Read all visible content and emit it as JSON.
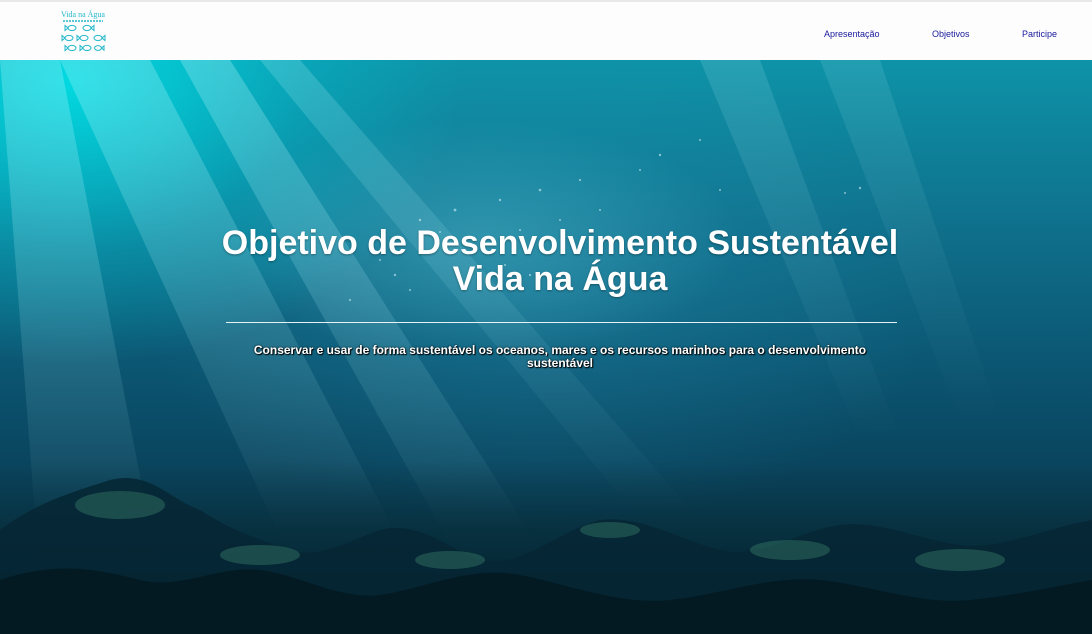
{
  "header": {
    "logo_text": "Vida na Água",
    "nav": [
      {
        "label": "Apresentação"
      },
      {
        "label": "Objetivos"
      },
      {
        "label": "Participe"
      }
    ]
  },
  "hero": {
    "title_line1": "Objetivo de Desenvolvimento Sustentável",
    "title_line2": "Vida na Água",
    "subtitle": "Conservar e usar de forma sustentável os oceanos, mares e os recursos marinhos para o desenvolvimento sustentável"
  },
  "colors": {
    "nav_link": "#1a1a9c",
    "logo_accent": "#21b7c9",
    "hero_text": "#ffffff"
  },
  "icons": {
    "logo": "fish-logo-icon"
  }
}
